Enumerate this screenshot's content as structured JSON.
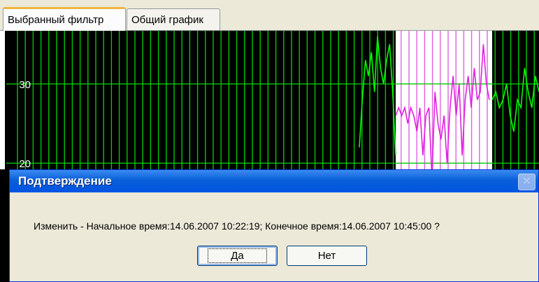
{
  "tabs": [
    {
      "label": "Выбранный фильтр",
      "active": true
    },
    {
      "label": "Общий график",
      "active": false
    }
  ],
  "chart_data": {
    "type": "line",
    "y_ticks": [
      "30",
      "20"
    ],
    "ylim": [
      5,
      36
    ],
    "background": "#000000",
    "grid_color": "#00c800",
    "series_color": "#00ff00",
    "selection_color": "#ffffff",
    "selection_series_color": "#e020e0",
    "grid": true,
    "series": [
      {
        "values": [
          22,
          28,
          33,
          31,
          34,
          29,
          36,
          32,
          30,
          33,
          35,
          29,
          21
        ]
      },
      {
        "values": [
          26,
          27,
          26,
          27,
          25,
          27,
          26,
          24,
          27,
          21,
          26,
          27,
          18,
          29,
          25,
          23,
          26,
          20,
          27,
          31,
          26,
          30,
          21,
          28,
          31,
          27,
          32,
          28,
          29,
          35,
          30,
          28
        ]
      },
      {
        "values": [
          28,
          29,
          27,
          28,
          30,
          26,
          24,
          28,
          27,
          32,
          29,
          27,
          31,
          29
        ]
      }
    ]
  },
  "dialog": {
    "title": "Подтверждение",
    "close_glyph": "✕",
    "message": "Изменить - Начальное время:14.06.2007 10:22:19; Конечное время:14.06.2007 10:45:00 ?",
    "yes_label": "Да",
    "no_label": "Нет"
  }
}
